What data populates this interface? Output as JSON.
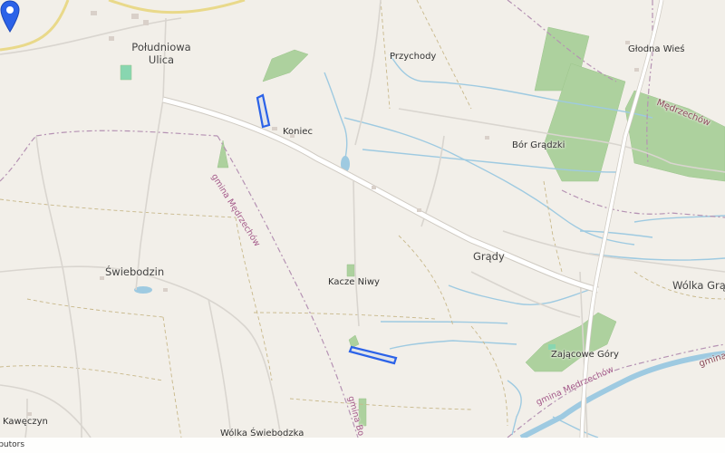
{
  "map": {
    "labels": {
      "poludniowa_line1": "Południowa",
      "poludniowa_line2": "Ulica",
      "przychody": "Przychody",
      "glodna_wies": "Głodna Wieś",
      "koniec": "Koniec",
      "bor_gradzki": "Bór Grądzki",
      "grady": "Grądy",
      "kacze_niwy": "Kacze Niwy",
      "swiebodzin": "Świebodzin",
      "wolka_gra": "Wólka Grą",
      "zajacowe_gory": "Zającowe Góry",
      "kaweczyn": "Kawęczyn",
      "wolka_swiebodzka": "Wólka Świebodzka",
      "gmina_bor_diag": "gmina Mędrzechów",
      "gmina_bottom_vert": "gmina Bo",
      "gmina_se": "gmina Mędrzechów",
      "road_medrzechow_ne": "Mędrzechów",
      "road_medrzechow_se": "gmina"
    },
    "colors": {
      "land": "#f2efe9",
      "water": "#9ecae1",
      "forest": "#add19e",
      "road_main": "#ffffff",
      "highlight": "#2b62e8",
      "marker": "#2b62e8"
    },
    "attribution": "ributors"
  }
}
